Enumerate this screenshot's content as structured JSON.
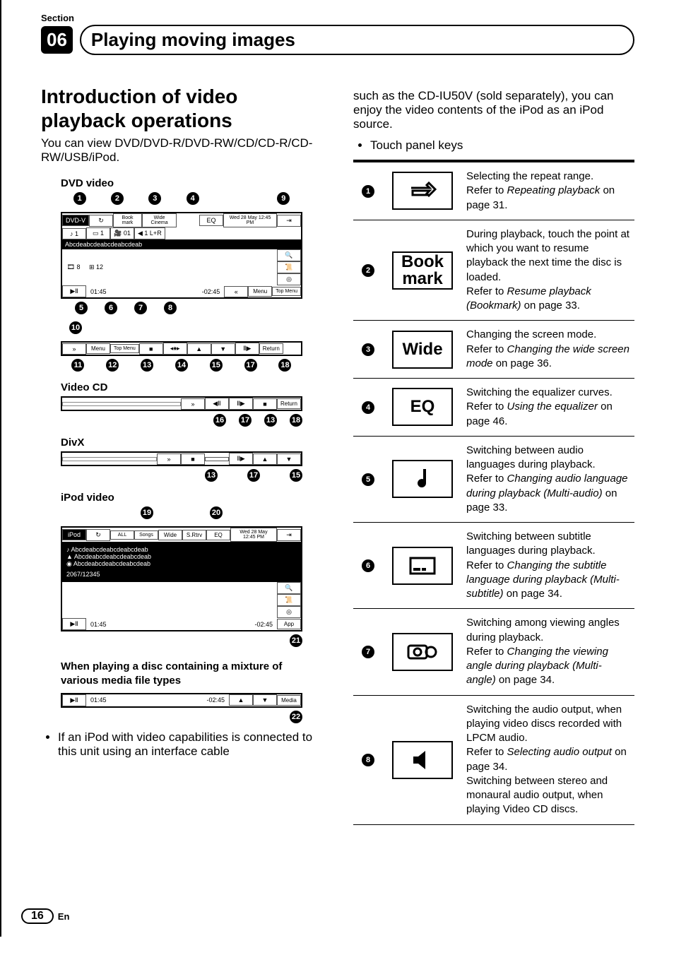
{
  "header": {
    "section_label": "Section",
    "section_number": "06",
    "chapter_title": "Playing moving images"
  },
  "left": {
    "intro_title": "Introduction of video playback operations",
    "intro_body": "You can view DVD/DVD-R/DVD-RW/CD/CD-R/CD-RW/USB/iPod.",
    "fig_dvd": "DVD video",
    "fig_vcd": "Video CD",
    "fig_divx": "DivX",
    "fig_ipod": "iPod video",
    "mixed_note": "When playing a disc containing a mixture of various media file types",
    "bullet1": "If an iPod with video capabilities is connected to this unit using an interface cable",
    "dvd_screen": {
      "source": "DVD-V",
      "bookmark": "Book mark",
      "wide": "Wide Cinema",
      "eq": "EQ",
      "clock": "Wed 28 May 12:45 PM",
      "track_text": "Abcdeabcdeabcdeabcdeab",
      "chapters": "8",
      "total": "12",
      "elapsed": "01:45",
      "remain": "-02:45",
      "menu": "Menu",
      "topmenu": "Top Menu",
      "return": "Return"
    },
    "vcd_screen": {
      "return": "Return"
    },
    "ipod_screen": {
      "source": "iPod",
      "mode_all": "ALL",
      "mode_songs": "Songs",
      "wide": "Wide",
      "srtrv": "S.Rtrv",
      "eq": "EQ",
      "clock": "Wed 28 May 12:45 PM",
      "line1": "Abcdeabcdeabcdeabcdeab",
      "line2": "Abcdeabcdeabcdeabcdeab",
      "line3": "Abcdeabcdeabcdeabcdeab",
      "num": "2067/12345",
      "elapsed": "01:45",
      "remain": "-02:45",
      "app": "App"
    },
    "mixed_bar": {
      "elapsed": "01:45",
      "remain": "-02:45",
      "media": "Media"
    }
  },
  "right": {
    "continuation": "such as the CD-IU50V (sold separately), you can enjoy the video contents of the iPod as an iPod source.",
    "bullet_touch": "Touch panel keys",
    "rows": [
      {
        "n": "1",
        "icon": "repeat",
        "desc": "Selecting the repeat range.\nRefer to <em>Repeating playback</em> on page 31."
      },
      {
        "n": "2",
        "icon_html": "Book<br>mark",
        "desc": "During playback, touch the point at which you want to resume playback the next time the disc is loaded.\nRefer to <em>Resume playback (Bookmark)</em> on page 33."
      },
      {
        "n": "3",
        "icon_html": "Wide",
        "desc": "Changing the screen mode.\nRefer to <em>Changing the wide screen mode</em> on page 36."
      },
      {
        "n": "4",
        "icon_html": "EQ",
        "desc": "Switching the equalizer curves.\nRefer to <em>Using the equalizer</em> on page 46."
      },
      {
        "n": "5",
        "icon": "note",
        "desc": "Switching between audio languages during playback.\nRefer to <em>Changing audio language during playback (Multi-audio)</em> on page 33."
      },
      {
        "n": "6",
        "icon": "subtitle",
        "desc": "Switching between subtitle languages during playback.\nRefer to <em>Changing the subtitle language during playback (Multi-subtitle)</em> on page 34."
      },
      {
        "n": "7",
        "icon": "camera",
        "desc": "Switching among viewing angles during playback.\nRefer to <em>Changing the viewing angle during playback (Multi-angle)</em> on page 34."
      },
      {
        "n": "8",
        "icon": "speaker",
        "desc": "Switching the audio output, when playing video discs recorded with LPCM audio.\nRefer to <em>Selecting audio output</em> on page 34.\nSwitching between stereo and monaural audio output, when playing Video CD discs."
      }
    ]
  },
  "footer": {
    "page": "16",
    "lang": "En"
  }
}
